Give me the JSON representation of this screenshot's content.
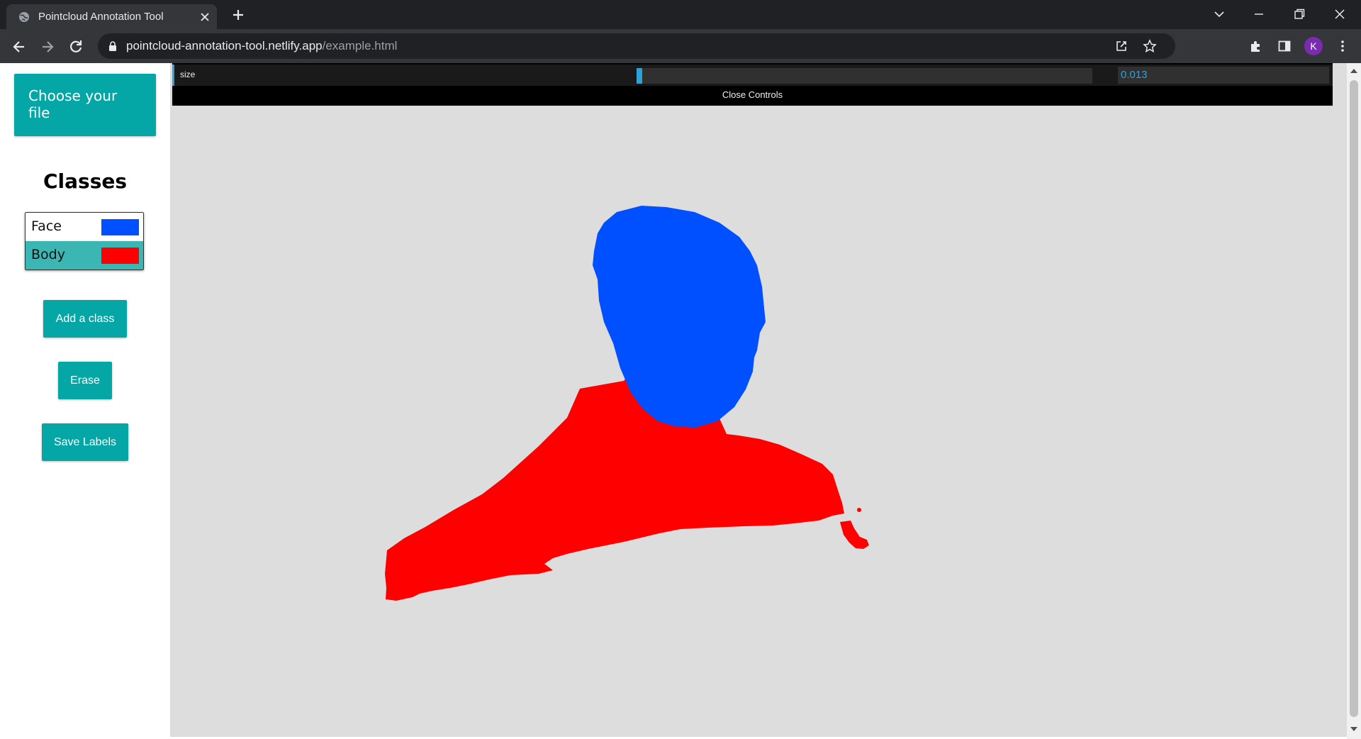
{
  "browser": {
    "tab_title": "Pointcloud Annotation Tool",
    "url_host": "pointcloud-annotation-tool.netlify.app",
    "url_path": "/example.html",
    "profile_initial": "K"
  },
  "sidebar": {
    "choose_file_label": "Choose your file",
    "classes_heading": "Classes",
    "classes": [
      {
        "name": "Face",
        "color": "#0050ff"
      },
      {
        "name": "Body",
        "color": "#ff0000"
      }
    ],
    "selected_class": "Body",
    "add_class_label": "Add a class",
    "erase_label": "Erase",
    "save_labels_label": "Save Labels"
  },
  "controls": {
    "size_label": "size",
    "size_value": "0.013",
    "size_slider_fraction": 0.006,
    "close_label": "Close Controls"
  },
  "colors": {
    "accent": "#05a7a6",
    "selected_row": "#3bb6b3",
    "gui_accent": "#2fa1d6",
    "viewer_bg": "#dddddd",
    "face": "#0050ff",
    "body": "#ff0000"
  }
}
